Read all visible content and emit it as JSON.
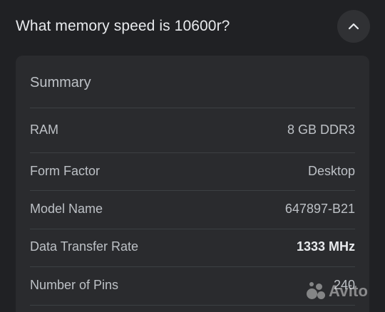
{
  "question": {
    "text": "What memory speed is 10600r?",
    "toggle_icon": "chevron-up-icon"
  },
  "summary": {
    "title": "Summary",
    "rows": [
      {
        "label": "RAM",
        "value": "8 GB DDR3",
        "bold": false
      },
      {
        "label": "Form Factor",
        "value": "Desktop",
        "bold": false
      },
      {
        "label": "Model Name",
        "value": "647897-B21",
        "bold": false
      },
      {
        "label": "Data Transfer Rate",
        "value": "1333 MHz",
        "bold": true
      },
      {
        "label": "Number of Pins",
        "value": "240",
        "bold": false
      }
    ]
  },
  "watermark": {
    "text": "Avito",
    "icon": "avito-logo-icon"
  },
  "colors": {
    "background": "#202124",
    "panel": "#2a2b2e",
    "text_primary": "#e8eaed",
    "text_secondary": "#bdc1c6",
    "divider": "#3c4043"
  }
}
